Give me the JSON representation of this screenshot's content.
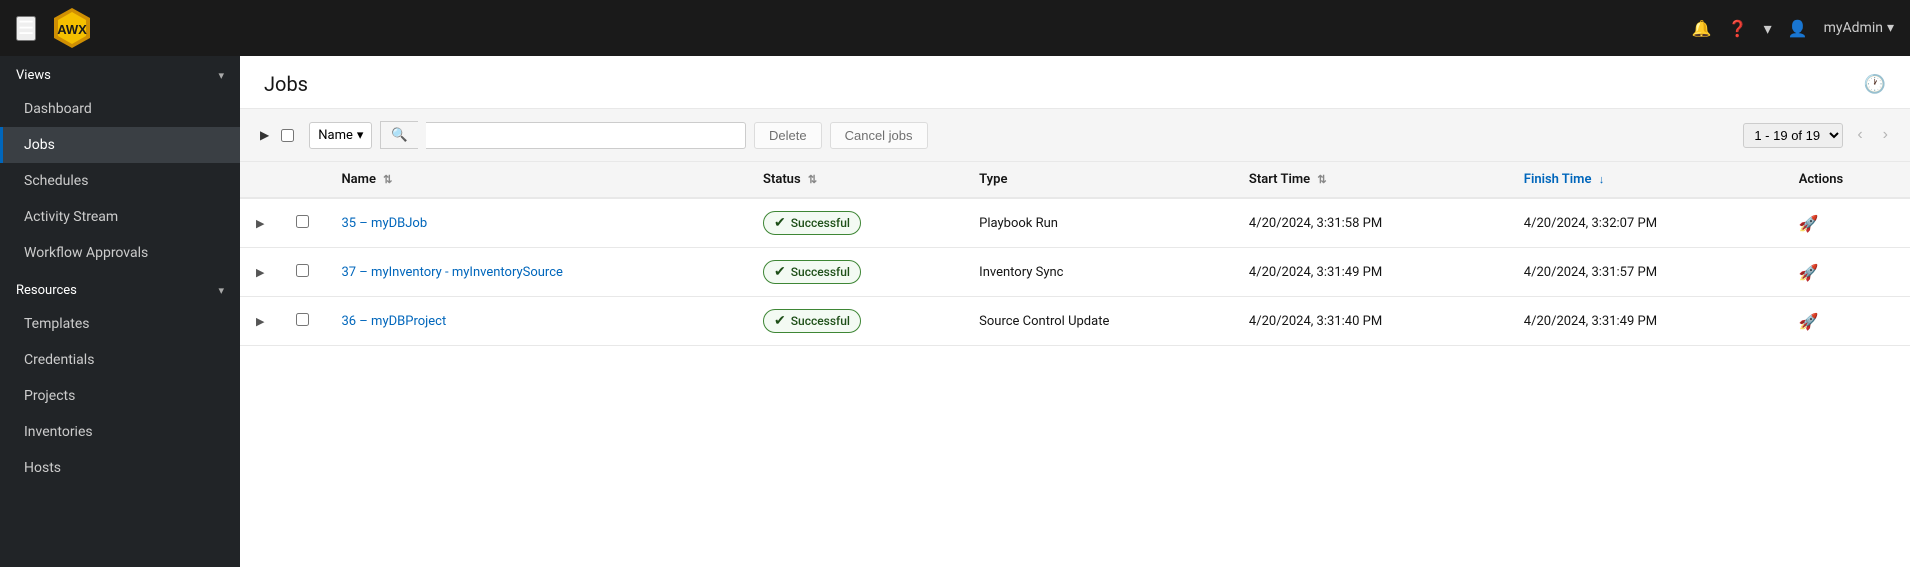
{
  "navbar": {
    "user_label": "myAdmin",
    "chevron_down": "▾"
  },
  "sidebar": {
    "views_label": "Views",
    "resources_label": "Resources",
    "views_items": [
      {
        "label": "Dashboard",
        "active": false,
        "id": "dashboard"
      },
      {
        "label": "Jobs",
        "active": true,
        "id": "jobs"
      },
      {
        "label": "Schedules",
        "active": false,
        "id": "schedules"
      },
      {
        "label": "Activity Stream",
        "active": false,
        "id": "activity-stream"
      },
      {
        "label": "Workflow Approvals",
        "active": false,
        "id": "workflow-approvals"
      }
    ],
    "resources_items": [
      {
        "label": "Templates",
        "active": false,
        "id": "templates"
      },
      {
        "label": "Credentials",
        "active": false,
        "id": "credentials"
      },
      {
        "label": "Projects",
        "active": false,
        "id": "projects"
      },
      {
        "label": "Inventories",
        "active": false,
        "id": "inventories"
      },
      {
        "label": "Hosts",
        "active": false,
        "id": "hosts"
      }
    ]
  },
  "page": {
    "title": "Jobs"
  },
  "toolbar": {
    "filter_label": "Name",
    "search_placeholder": "",
    "delete_label": "Delete",
    "cancel_jobs_label": "Cancel jobs",
    "pagination_text": "1 - 19 of 19",
    "pagination_option": "1 - 19 of 19"
  },
  "table": {
    "columns": [
      {
        "label": "Name",
        "id": "name",
        "sortable": true,
        "sorted": false,
        "sort_dir": ""
      },
      {
        "label": "Status",
        "id": "status",
        "sortable": true,
        "sorted": false,
        "sort_dir": ""
      },
      {
        "label": "Type",
        "id": "type",
        "sortable": false,
        "sorted": false,
        "sort_dir": ""
      },
      {
        "label": "Start Time",
        "id": "start_time",
        "sortable": true,
        "sorted": false,
        "sort_dir": ""
      },
      {
        "label": "Finish Time",
        "id": "finish_time",
        "sortable": true,
        "sorted": true,
        "sort_dir": "desc"
      },
      {
        "label": "Actions",
        "id": "actions",
        "sortable": false,
        "sorted": false,
        "sort_dir": ""
      }
    ],
    "rows": [
      {
        "id": "35",
        "name": "35 – myDBJob",
        "status": "Successful",
        "type": "Playbook Run",
        "start_time": "4/20/2024, 3:31:58 PM",
        "finish_time": "4/20/2024, 3:32:07 PM"
      },
      {
        "id": "37",
        "name": "37 – myInventory - myInventorySource",
        "status": "Successful",
        "type": "Inventory Sync",
        "start_time": "4/20/2024, 3:31:49 PM",
        "finish_time": "4/20/2024, 3:31:57 PM"
      },
      {
        "id": "36",
        "name": "36 – myDBProject",
        "status": "Successful",
        "type": "Source Control Update",
        "start_time": "4/20/2024, 3:31:40 PM",
        "finish_time": "4/20/2024, 3:31:49 PM"
      }
    ]
  }
}
